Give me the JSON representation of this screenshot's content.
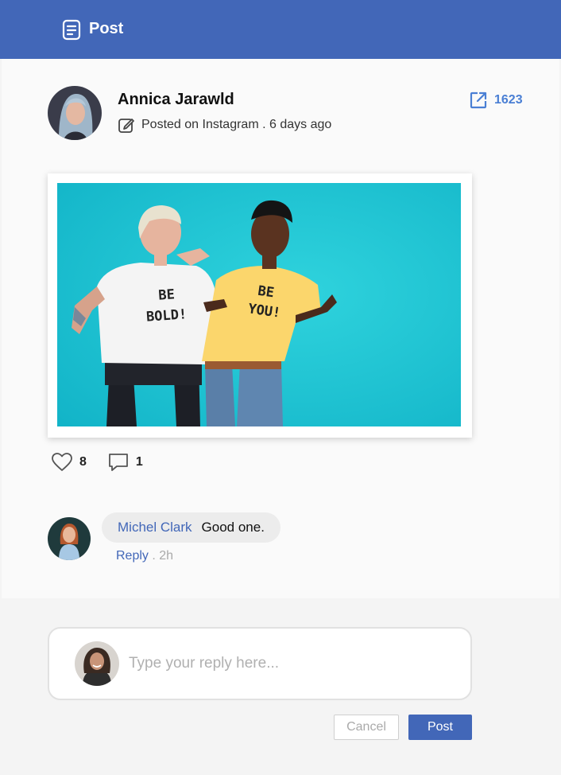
{
  "header": {
    "title": "Post",
    "icon": "document-icon",
    "color": "#4267b8"
  },
  "post": {
    "author": "Annica Jarawld",
    "meta": "Posted on Instagram . 6 days ago",
    "share_count": "1623",
    "likes": "8",
    "comments": "1",
    "image_text_left": "BE BOLD!",
    "image_text_right": "BE YOU!"
  },
  "comment": {
    "author": "Michel Clark",
    "text": "Good one.",
    "reply_label": "Reply",
    "time": " . 2h"
  },
  "reply": {
    "placeholder": "Type your reply here...",
    "cancel_label": "Cancel",
    "post_label": "Post"
  },
  "colors": {
    "accent": "#4267b8",
    "link": "#4a7fd4",
    "photo_bg": "#1cc3d3"
  }
}
